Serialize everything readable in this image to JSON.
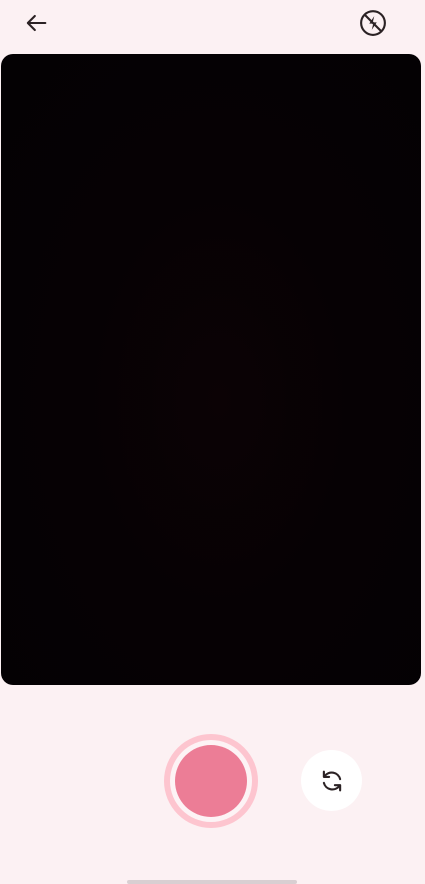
{
  "top_bar": {
    "back_icon": "arrow-left-icon",
    "flash_icon": "flash-off-icon"
  },
  "viewfinder": {
    "state": "camera-preview-dark"
  },
  "controls": {
    "shutter_icon": "record-shutter-icon",
    "flip_icon": "switch-camera-icon"
  },
  "colors": {
    "background": "#fcf1f3",
    "viewfinder": "#050103",
    "shutter_core": "#ec7d96",
    "shutter_ring": "#fdc5cf",
    "icon": "#2b2224"
  }
}
